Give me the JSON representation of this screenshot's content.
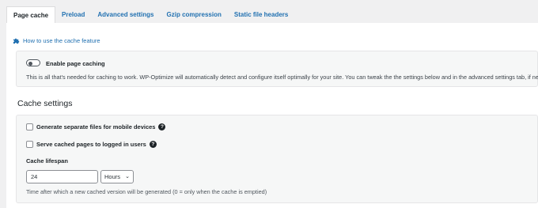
{
  "tabs": [
    {
      "label": "Page cache",
      "active": true
    },
    {
      "label": "Preload",
      "active": false
    },
    {
      "label": "Advanced settings",
      "active": false
    },
    {
      "label": "Gzip compression",
      "active": false
    },
    {
      "label": "Static file headers",
      "active": false
    }
  ],
  "howto_link": "How to use the cache feature",
  "enable": {
    "label": "Enable page caching",
    "state": "off",
    "description": "This is all that's needed for caching to work. WP-Optimize will automatically detect and configure itself optimally for your site. You can tweak the the settings below and in the advanced settings tab, if needed."
  },
  "cache_settings": {
    "title": "Cache settings",
    "mobile_label": "Generate separate files for mobile devices",
    "mobile_checked": false,
    "logged_in_label": "Serve cached pages to logged in users",
    "logged_in_checked": false,
    "lifespan_label": "Cache lifespan",
    "lifespan_value": "24",
    "lifespan_unit": "Hours",
    "lifespan_hint": "Time after which a new cached version will be generated (0 = only when the cache is emptied)"
  },
  "icons": {
    "puzzle": "puzzle-piece-icon",
    "help": "question-circle-icon"
  },
  "colors": {
    "link": "#2271b1",
    "background": "#f0f0f1",
    "panel": "#ffffff"
  }
}
